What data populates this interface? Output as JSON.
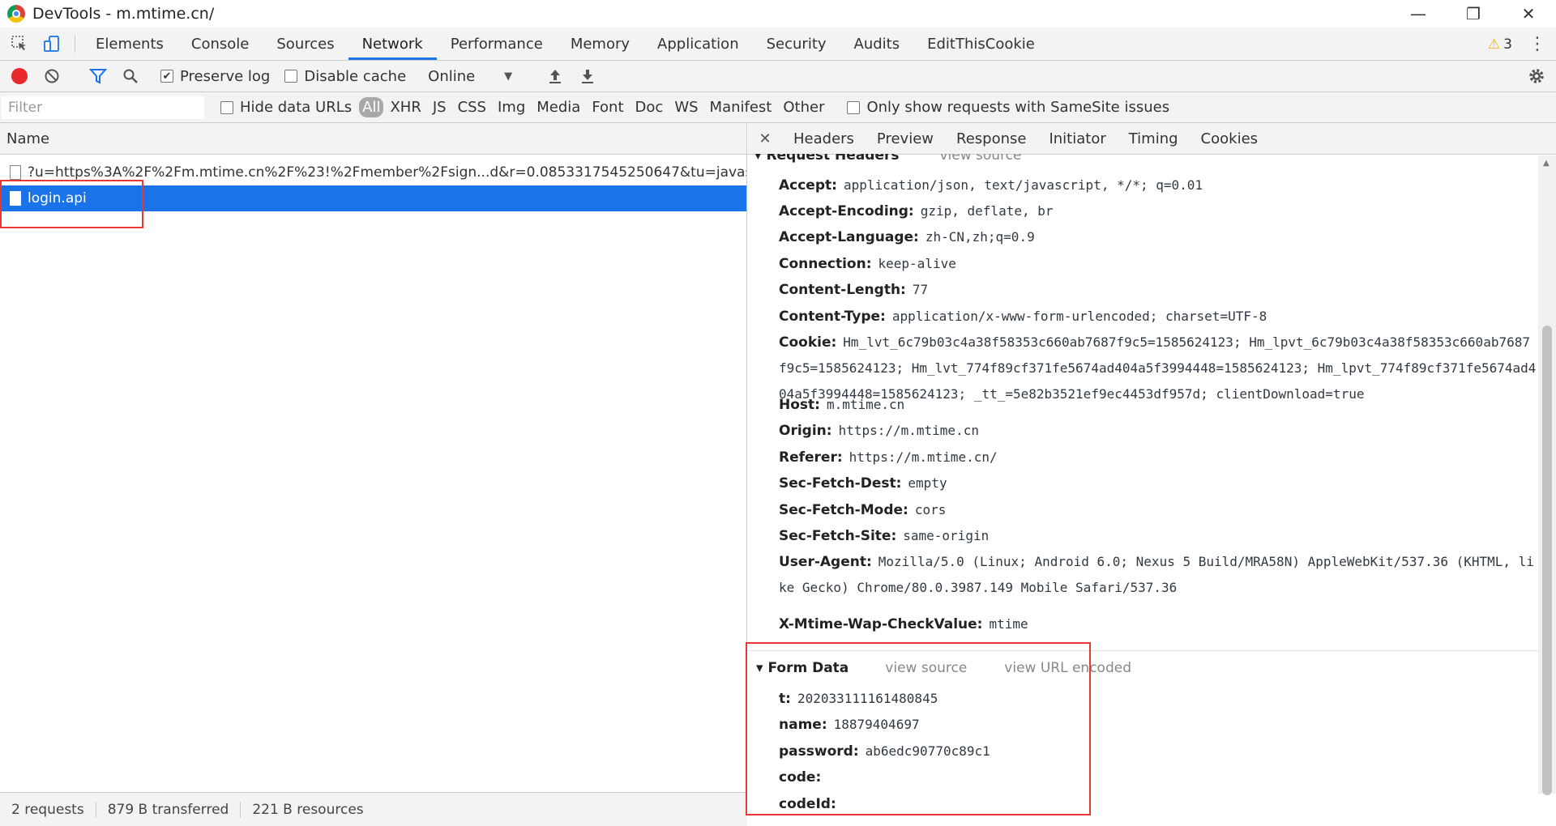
{
  "window": {
    "title": "DevTools - m.mtime.cn/"
  },
  "main_tabs": [
    "Elements",
    "Console",
    "Sources",
    "Network",
    "Performance",
    "Memory",
    "Application",
    "Security",
    "Audits",
    "EditThisCookie"
  ],
  "active_main_tab": "Network",
  "warnings_count": "3",
  "toolbar": {
    "preserve_log_label": "Preserve log",
    "preserve_log_checked": true,
    "disable_cache_label": "Disable cache",
    "disable_cache_checked": false,
    "throttle_value": "Online"
  },
  "filterbar": {
    "placeholder": "Filter",
    "hide_data_urls_label": "Hide data URLs",
    "types": [
      "All",
      "XHR",
      "JS",
      "CSS",
      "Img",
      "Media",
      "Font",
      "Doc",
      "WS",
      "Manifest",
      "Other"
    ],
    "active_type": "All",
    "samesite_label": "Only show requests with SameSite issues"
  },
  "request_list": {
    "column_header": "Name",
    "rows": [
      {
        "name": "?u=https%3A%2F%2Fm.mtime.cn%2F%23!%2Fmember%2Fsign...d&r=0.0853317545250647&tu=javascript%...",
        "selected": false
      },
      {
        "name": "login.api",
        "selected": true
      }
    ]
  },
  "status": {
    "requests": "2 requests",
    "transferred": "879 B transferred",
    "resources": "221 B resources"
  },
  "detail_tabs": [
    "Headers",
    "Preview",
    "Response",
    "Initiator",
    "Timing",
    "Cookies"
  ],
  "request_headers": {
    "title": "Request Headers",
    "view_source": "view source",
    "rows": [
      {
        "key": "Accept:",
        "value": "application/json, text/javascript, */*; q=0.01"
      },
      {
        "key": "Accept-Encoding:",
        "value": "gzip, deflate, br"
      },
      {
        "key": "Accept-Language:",
        "value": "zh-CN,zh;q=0.9"
      },
      {
        "key": "Connection:",
        "value": "keep-alive"
      },
      {
        "key": "Content-Length:",
        "value": "77"
      },
      {
        "key": "Content-Type:",
        "value": "application/x-www-form-urlencoded; charset=UTF-8"
      },
      {
        "key": "Cookie:",
        "value": "Hm_lvt_6c79b03c4a38f58353c660ab7687f9c5=1585624123; Hm_lpvt_6c79b03c4a38f58353c660ab7687f9c5=1585624123; Hm_lvt_774f89cf371fe5674ad404a5f3994448=1585624123; Hm_lpvt_774f89cf371fe5674ad404a5f3994448=1585624123; _tt_=5e82b3521ef9ec4453df957d; clientDownload=true"
      },
      {
        "key": "Host:",
        "value": "m.mtime.cn"
      },
      {
        "key": "Origin:",
        "value": "https://m.mtime.cn"
      },
      {
        "key": "Referer:",
        "value": "https://m.mtime.cn/"
      },
      {
        "key": "Sec-Fetch-Dest:",
        "value": "empty"
      },
      {
        "key": "Sec-Fetch-Mode:",
        "value": "cors"
      },
      {
        "key": "Sec-Fetch-Site:",
        "value": "same-origin"
      },
      {
        "key": "User-Agent:",
        "value": "Mozilla/5.0 (Linux; Android 6.0; Nexus 5 Build/MRA58N) AppleWebKit/537.36 (KHTML, like Gecko) Chrome/80.0.3987.149 Mobile Safari/537.36"
      },
      {
        "key": "X-Mtime-Wap-CheckValue:",
        "value": "mtime"
      }
    ]
  },
  "form_data": {
    "title": "Form Data",
    "view_source": "view source",
    "view_url_encoded": "view URL encoded",
    "rows": [
      {
        "key": "t:",
        "value": "202033111161480845"
      },
      {
        "key": "name:",
        "value": "18879404697"
      },
      {
        "key": "password:",
        "value": "ab6edc90770c89c1"
      },
      {
        "key": "code:",
        "value": ""
      },
      {
        "key": "codeId:",
        "value": ""
      }
    ]
  },
  "colors": {
    "accent": "#1a73e8",
    "record": "#e8282a",
    "highlight_box": "#e53935"
  }
}
